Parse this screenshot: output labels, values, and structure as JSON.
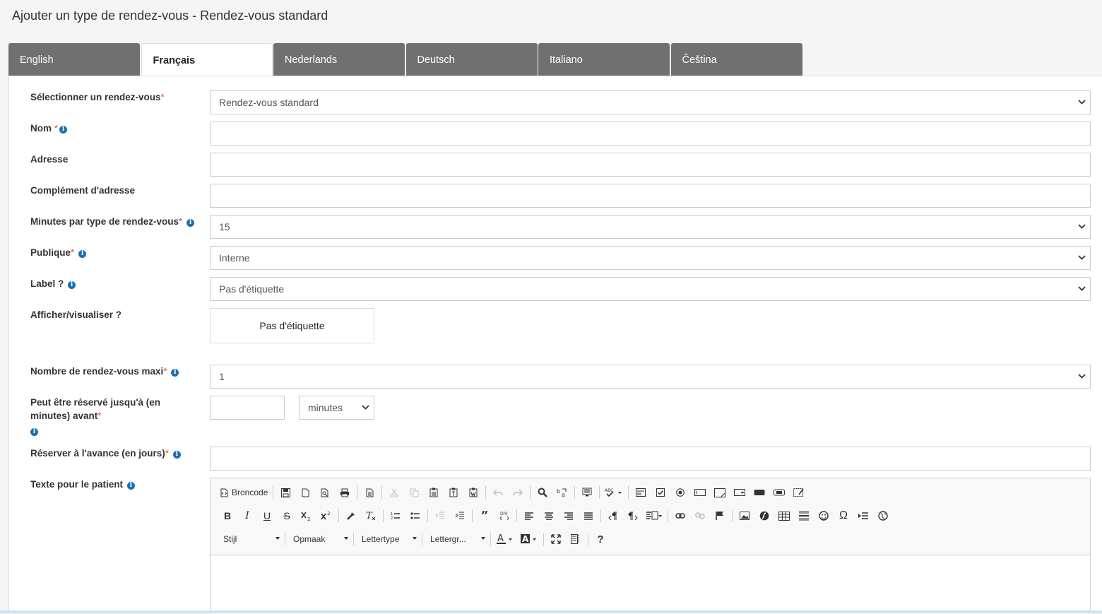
{
  "header": {
    "title": "Ajouter un type de rendez-vous - Rendez-vous standard"
  },
  "tabs": [
    {
      "label": "English"
    },
    {
      "label": "Français"
    },
    {
      "label": "Nederlands"
    },
    {
      "label": "Deutsch"
    },
    {
      "label": "Italiano"
    },
    {
      "label": "Čeština"
    }
  ],
  "form": {
    "select_appointment": {
      "label": "Sélectionner un rendez-vous",
      "value": "Rendez-vous standard"
    },
    "name": {
      "label": "Nom",
      "value": ""
    },
    "address": {
      "label": "Adresse",
      "value": ""
    },
    "address_extra": {
      "label": "Complément d'adresse",
      "value": ""
    },
    "minutes": {
      "label": "Minutes par type de rendez-vous",
      "value": "15"
    },
    "public": {
      "label": "Publique",
      "value": "Interne"
    },
    "label": {
      "label": "Label ?",
      "value": "Pas d'étiquette"
    },
    "display": {
      "label": "Afficher/visualiser ?",
      "preview": "Pas d'étiquette"
    },
    "max_appointments": {
      "label": "Nombre de rendez-vous maxi",
      "value": "1"
    },
    "book_until": {
      "label_line1": "Peut être réservé jusqu'à (en",
      "label_line2": "minutes) avant",
      "value": "",
      "unit": "minutes"
    },
    "book_ahead": {
      "label": "Réserver à l'avance (en jours)",
      "value": ""
    },
    "patient_text": {
      "label": "Texte pour le patient"
    },
    "required_mark": "*",
    "info_mark": "i"
  },
  "editor": {
    "source_label": "Broncode",
    "style_combo": "Stijl",
    "format_combo": "Opmaak",
    "font_combo": "Lettertype",
    "size_combo": "Lettergr...",
    "help": "?"
  }
}
